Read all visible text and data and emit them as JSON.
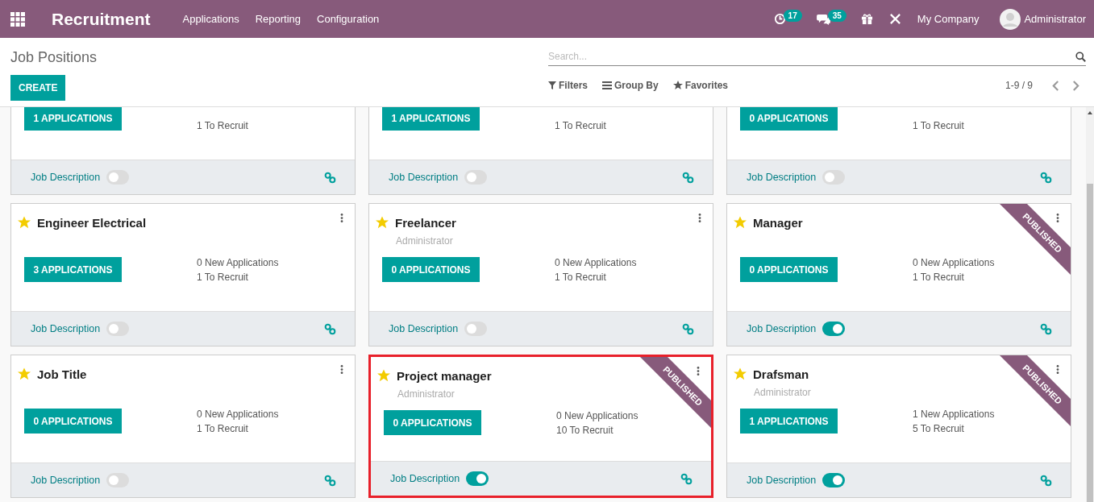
{
  "navbar": {
    "app_name": "Recruitment",
    "menu": [
      "Applications",
      "Reporting",
      "Configuration"
    ],
    "activity_count": "17",
    "message_count": "35",
    "company": "My Company",
    "user": "Administrator"
  },
  "control_panel": {
    "breadcrumb": "Job Positions",
    "create_label": "CREATE",
    "search": {
      "placeholder": "Search..."
    },
    "filters": "Filters",
    "group_by": "Group By",
    "favorites": "Favorites",
    "pager": "1-9 / 9"
  },
  "cards": [
    {
      "applications": "1 APPLICATIONS",
      "to_recruit": "1 To Recruit",
      "job_description": "Job Description",
      "description_on": false,
      "selected": false
    },
    {
      "applications": "1 APPLICATIONS",
      "to_recruit": "1 To Recruit",
      "job_description": "Job Description",
      "description_on": false,
      "selected": false
    },
    {
      "applications": "0 APPLICATIONS",
      "to_recruit": "1 To Recruit",
      "job_description": "Job Description",
      "description_on": false,
      "selected": false
    },
    {
      "title": "Engineer Electrical",
      "favorite": true,
      "applications": "3 APPLICATIONS",
      "new_applications": "0 New Applications",
      "to_recruit": "1 To Recruit",
      "job_description": "Job Description",
      "description_on": false,
      "selected": false
    },
    {
      "title": "Freelancer",
      "favorite": true,
      "subtitle": "Administrator",
      "applications": "0 APPLICATIONS",
      "new_applications": "0 New Applications",
      "to_recruit": "1 To Recruit",
      "job_description": "Job Description",
      "description_on": false,
      "selected": false
    },
    {
      "title": "Manager",
      "favorite": true,
      "ribbon": "PUBLISHED",
      "applications": "0 APPLICATIONS",
      "new_applications": "0 New Applications",
      "to_recruit": "1 To Recruit",
      "job_description": "Job Description",
      "description_on": true,
      "selected": false
    },
    {
      "title": "Job Title",
      "favorite": true,
      "applications": "0 APPLICATIONS",
      "new_applications": "0 New Applications",
      "to_recruit": "1 To Recruit",
      "job_description": "Job Description",
      "description_on": false,
      "selected": false
    },
    {
      "title": "Project manager",
      "favorite": true,
      "subtitle": "Administrator",
      "ribbon": "PUBLISHED",
      "applications": "0 APPLICATIONS",
      "new_applications": "0 New Applications",
      "to_recruit": "10 To Recruit",
      "job_description": "Job Description",
      "description_on": true,
      "selected": true
    },
    {
      "title": "Drafsman",
      "favorite": true,
      "subtitle": "Administrator",
      "ribbon": "PUBLISHED",
      "applications": "1 APPLICATIONS",
      "new_applications": "1 New Applications",
      "to_recruit": "5 To Recruit",
      "job_description": "Job Description",
      "description_on": true,
      "selected": false
    }
  ]
}
